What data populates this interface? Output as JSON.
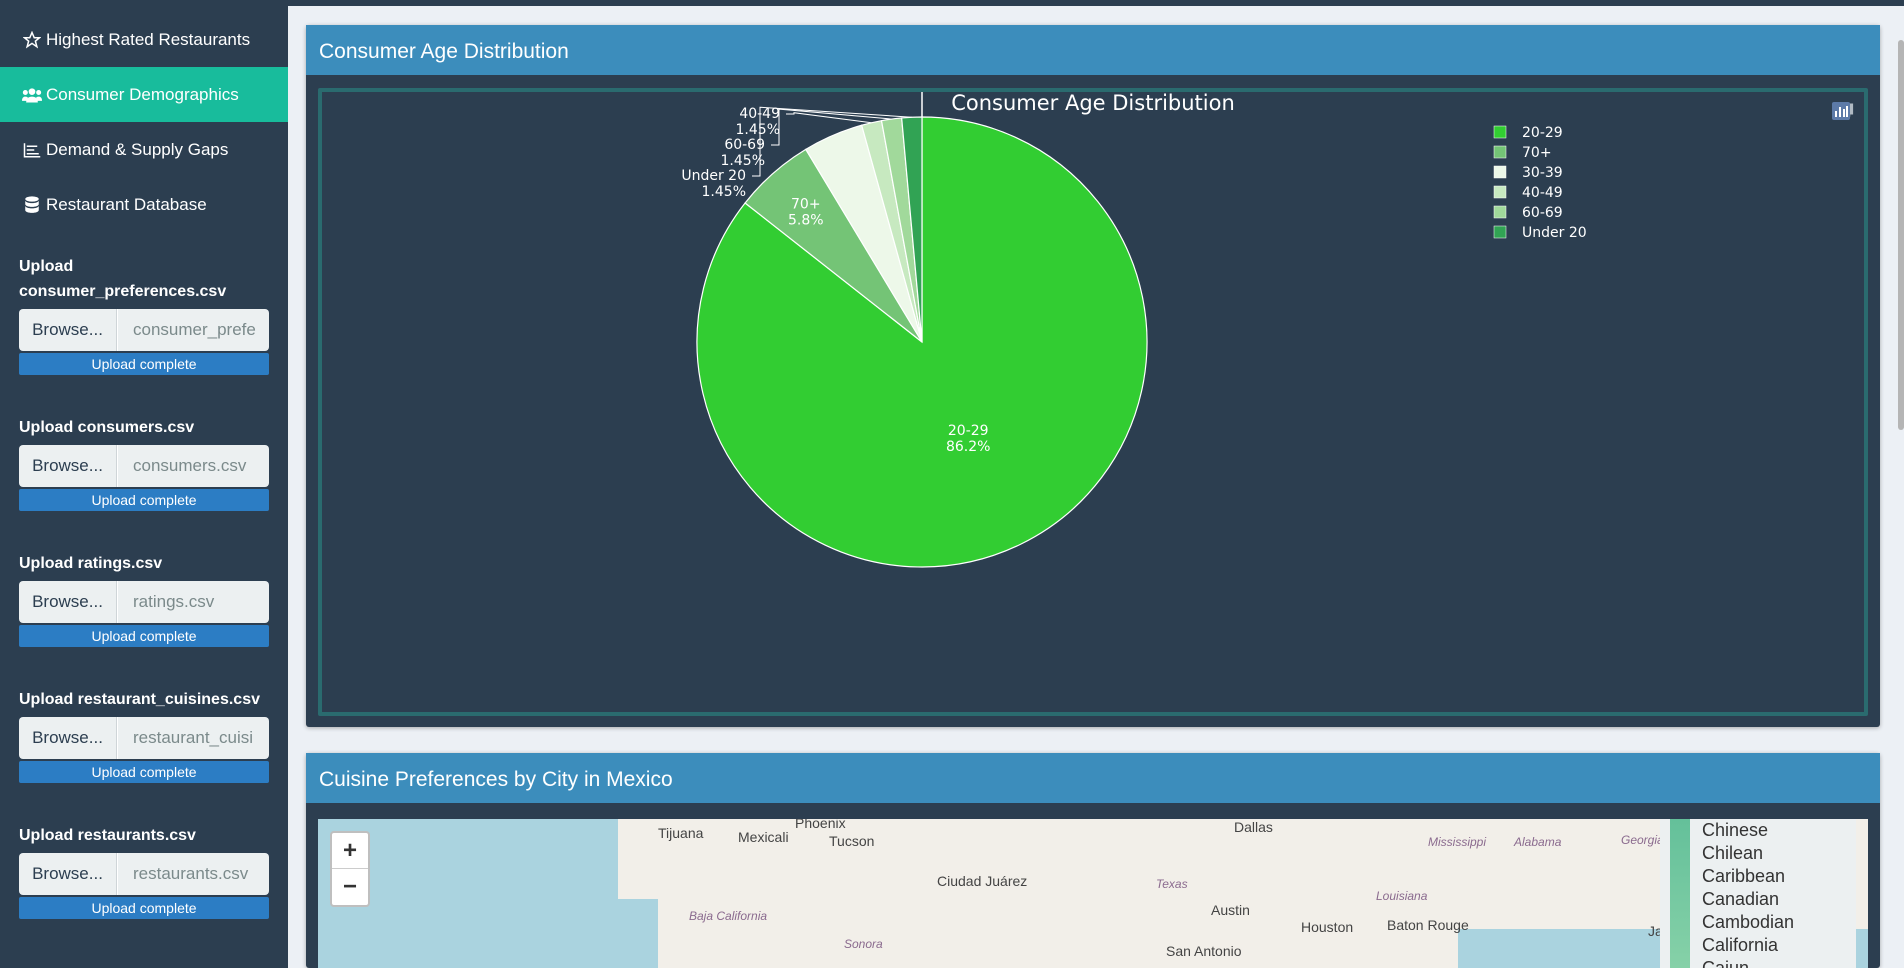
{
  "sidebar": {
    "items": [
      {
        "label": "Highest Rated Restaurants",
        "icon": "star-icon",
        "active": false
      },
      {
        "label": "Consumer Demographics",
        "icon": "users-icon",
        "active": true
      },
      {
        "label": "Demand & Supply Gaps",
        "icon": "bar-chart-icon",
        "active": false
      },
      {
        "label": "Restaurant Database",
        "icon": "database-icon",
        "active": false
      }
    ],
    "uploads": [
      {
        "label": "Upload consumer_preferences.csv",
        "browse": "Browse...",
        "file": "consumer_prefe",
        "status": "Upload complete"
      },
      {
        "label": "Upload consumers.csv",
        "browse": "Browse...",
        "file": "consumers.csv",
        "status": "Upload complete"
      },
      {
        "label": "Upload ratings.csv",
        "browse": "Browse...",
        "file": "ratings.csv",
        "status": "Upload complete"
      },
      {
        "label": "Upload restaurant_cuisines.csv",
        "browse": "Browse...",
        "file": "restaurant_cuisi",
        "status": "Upload complete"
      },
      {
        "label": "Upload restaurants.csv",
        "browse": "Browse...",
        "file": "restaurants.csv",
        "status": "Upload complete"
      }
    ]
  },
  "box1": {
    "title": "Consumer Age Distribution"
  },
  "box2": {
    "title": "Cuisine Preferences by City in Mexico"
  },
  "chart_data": {
    "type": "pie",
    "title": "Consumer Age Distribution",
    "slices": [
      {
        "label": "20-29",
        "value": 86.2,
        "display": "86.2%",
        "color": "#32cd32"
      },
      {
        "label": "70+",
        "value": 5.8,
        "display": "5.8%",
        "color": "#74c476"
      },
      {
        "label": "30-39",
        "value": 4.35,
        "display": "",
        "color": "#edf8e9"
      },
      {
        "label": "40-49",
        "value": 1.45,
        "display": "1.45%",
        "color": "#c7e9c0"
      },
      {
        "label": "60-69",
        "value": 1.45,
        "display": "1.45%",
        "color": "#a1d99b"
      },
      {
        "label": "Under 20",
        "value": 1.45,
        "display": "1.45%",
        "color": "#31a354"
      }
    ],
    "legend_position": "top-right"
  },
  "map": {
    "zoom_in": "+",
    "zoom_out": "−",
    "labels": [
      "Phoenix",
      "Tijuana",
      "Mexicali",
      "Tucson",
      "Dallas",
      "Ciudad Juárez",
      "Austin",
      "Houston",
      "Baton Rouge",
      "San Antonio",
      "Sonora",
      "Baja California",
      "Texas",
      "Louisiana",
      "Mississippi",
      "Alabama",
      "Georgia",
      "Ja"
    ],
    "legend": [
      "Chinese",
      "Chilean",
      "Caribbean",
      "Canadian",
      "Cambodian",
      "California",
      "Cajun"
    ]
  },
  "modebar": [
    "camera-icon",
    "tag-icon",
    "plotly-icon"
  ]
}
